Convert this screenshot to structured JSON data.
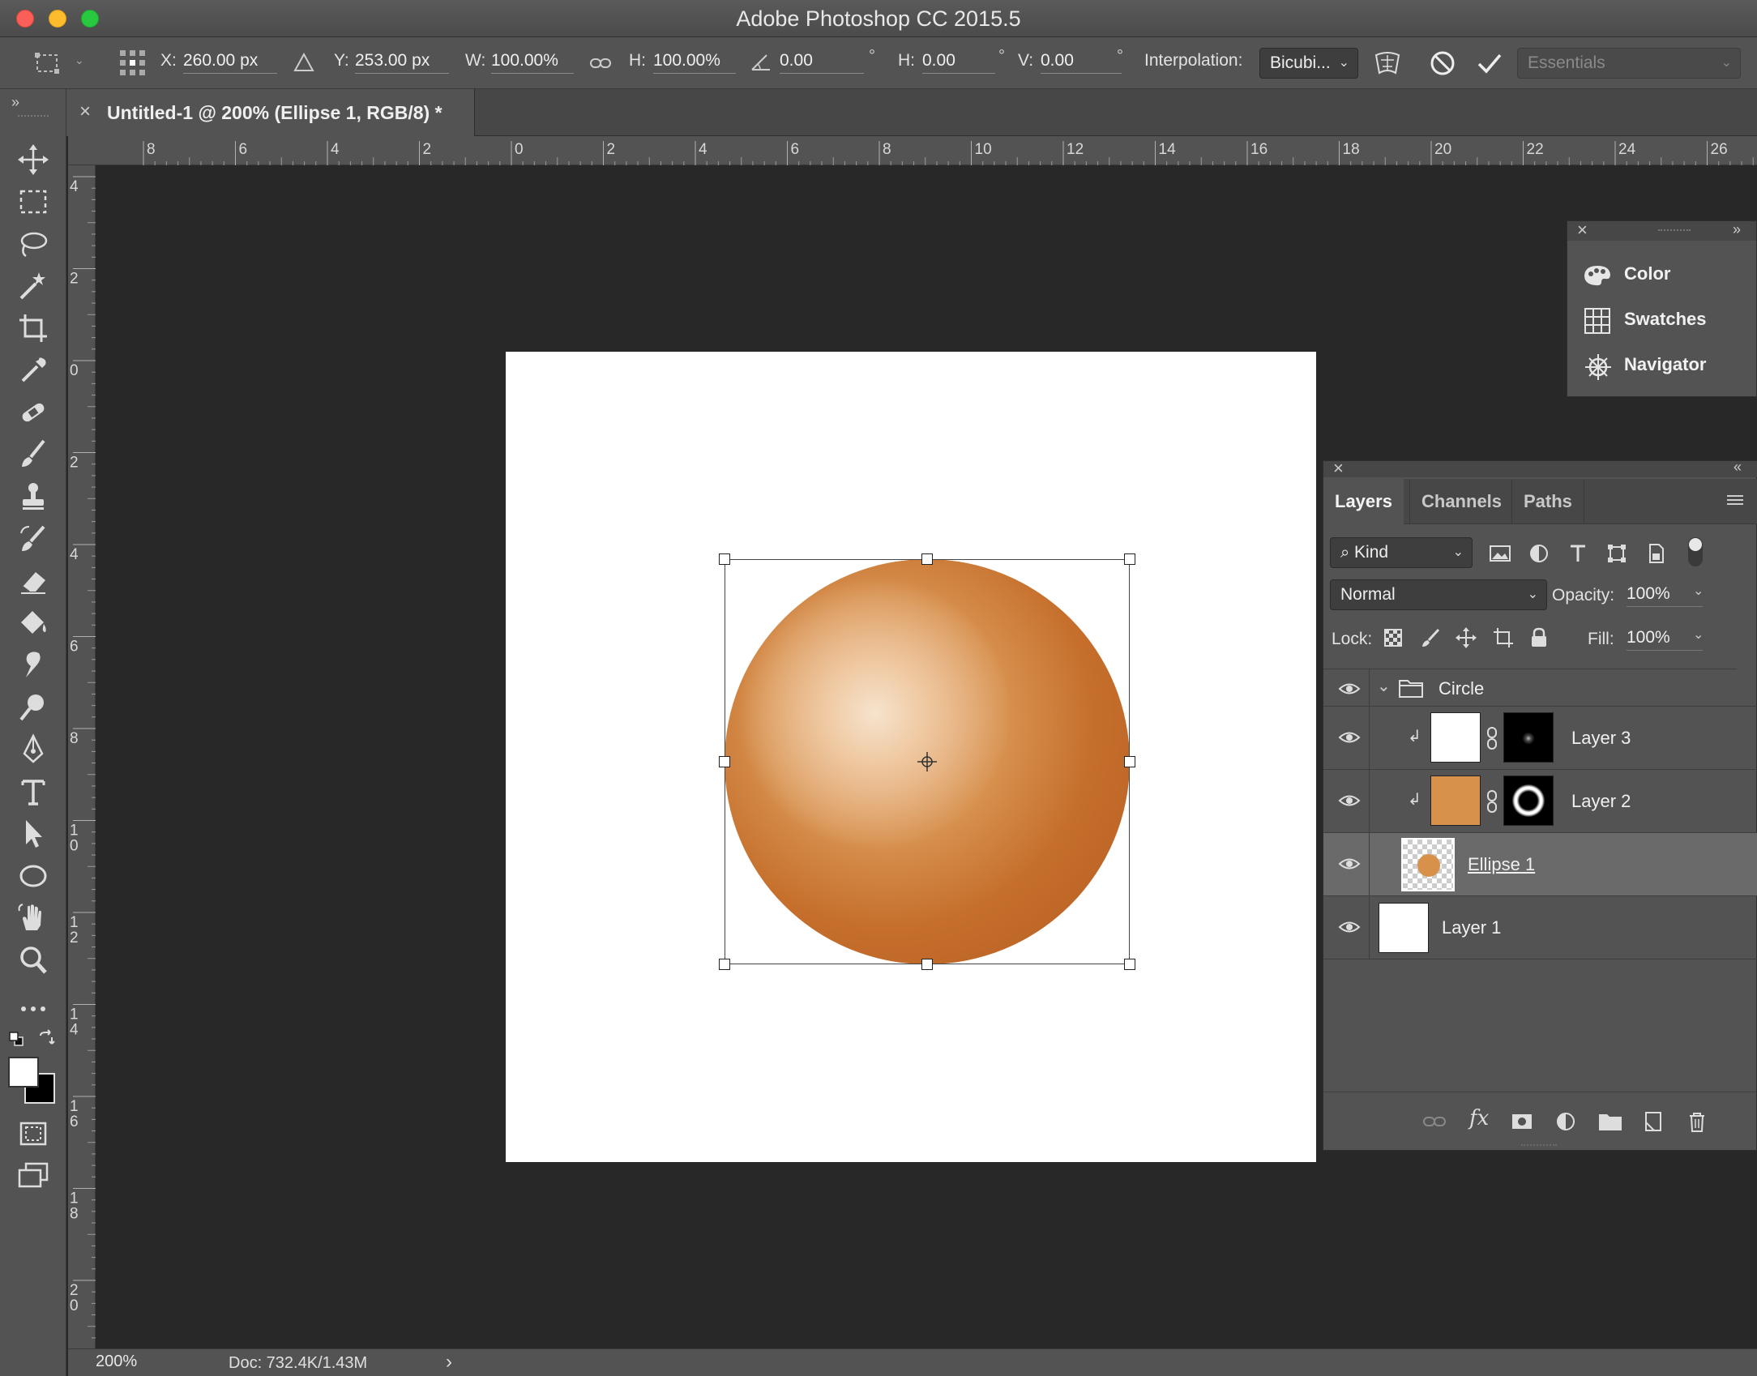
{
  "window": {
    "title": "Adobe Photoshop CC 2015.5"
  },
  "options": {
    "x_label": "X:",
    "x_value": "260.00 px",
    "y_label": "Y:",
    "y_value": "253.00 px",
    "w_label": "W:",
    "w_value": "100.00%",
    "h_label": "H:",
    "h_value": "100.00%",
    "angle_value": "0.00",
    "deg": "°",
    "hskew_label": "H:",
    "hskew_value": "0.00",
    "vskew_label": "V:",
    "vskew_value": "0.00",
    "interp_label": "Interpolation:",
    "interp_value": "Bicubi...",
    "workspace": "Essentials"
  },
  "tab": {
    "close": "×",
    "title": "Untitled-1 @ 200% (Ellipse 1, RGB/8) *"
  },
  "ruler_top": [
    "8",
    "6",
    "4",
    "2",
    "0",
    "2",
    "4",
    "6",
    "8",
    "10",
    "12",
    "14",
    "16",
    "18",
    "20",
    "22",
    "24",
    "26"
  ],
  "ruler_left": [
    "4",
    "2",
    "0",
    "2",
    "4",
    "6",
    "8",
    "10",
    "12",
    "14",
    "16",
    "18",
    "20"
  ],
  "status": {
    "zoom": "200%",
    "doc": "Doc: 732.4K/1.43M",
    "arrow": "›"
  },
  "mini_panel": {
    "items": [
      "Color",
      "Swatches",
      "Navigator"
    ]
  },
  "layers_panel": {
    "tabs": [
      "Layers",
      "Channels",
      "Paths"
    ],
    "filter_label": "Kind",
    "blend_mode": "Normal",
    "opacity_label": "Opacity:",
    "opacity_value": "100%",
    "lock_label": "Lock:",
    "fill_label": "Fill:",
    "fill_value": "100%",
    "layers": [
      "Circle",
      "Layer 3",
      "Layer 2",
      "Ellipse 1",
      "Layer 1"
    ]
  },
  "colors": {
    "accent_orange": "#d8914a",
    "panel_bg": "#535353",
    "canvas_bg": "#282828"
  }
}
